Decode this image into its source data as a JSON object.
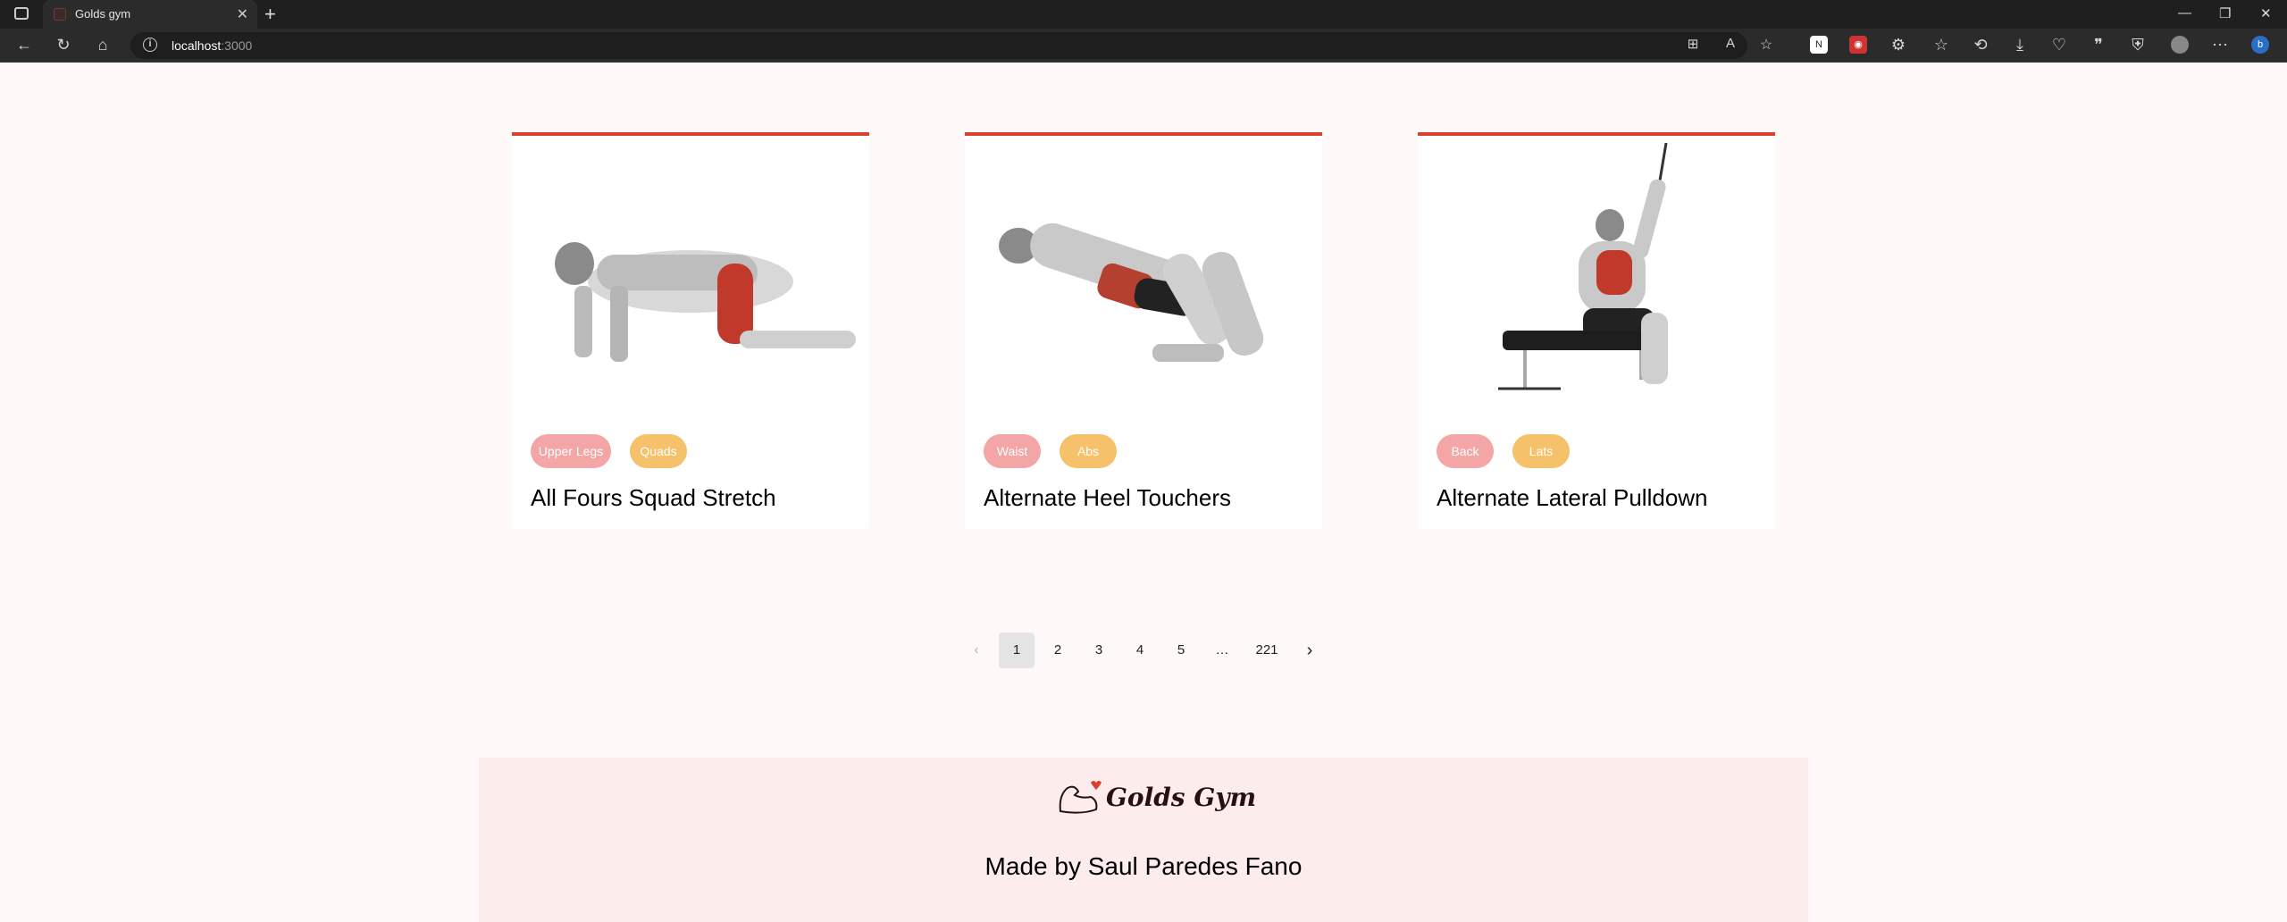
{
  "browser": {
    "tab_title": "Golds gym",
    "url_host": "localhost",
    "url_port": ":3000"
  },
  "exercises": [
    {
      "name": "All Fours Squad Stretch",
      "body_part": "Upper Legs",
      "target": "Quads"
    },
    {
      "name": "Alternate Heel Touchers",
      "body_part": "Waist",
      "target": "Abs"
    },
    {
      "name": "Alternate Lateral Pulldown",
      "body_part": "Back",
      "target": "Lats"
    }
  ],
  "pagination": {
    "pages": [
      "1",
      "2",
      "3",
      "4",
      "5"
    ],
    "ellipsis": "…",
    "last_page": "221",
    "current": "1"
  },
  "footer": {
    "brand": "Golds Gym",
    "credit": "Made by Saul Paredes Fano"
  },
  "colors": {
    "accent": "#d9412e",
    "tag_pink": "#f4a6a6",
    "tag_yellow": "#f5c26b",
    "page_bg": "#fff8f8",
    "footer_bg": "#fcecec"
  }
}
